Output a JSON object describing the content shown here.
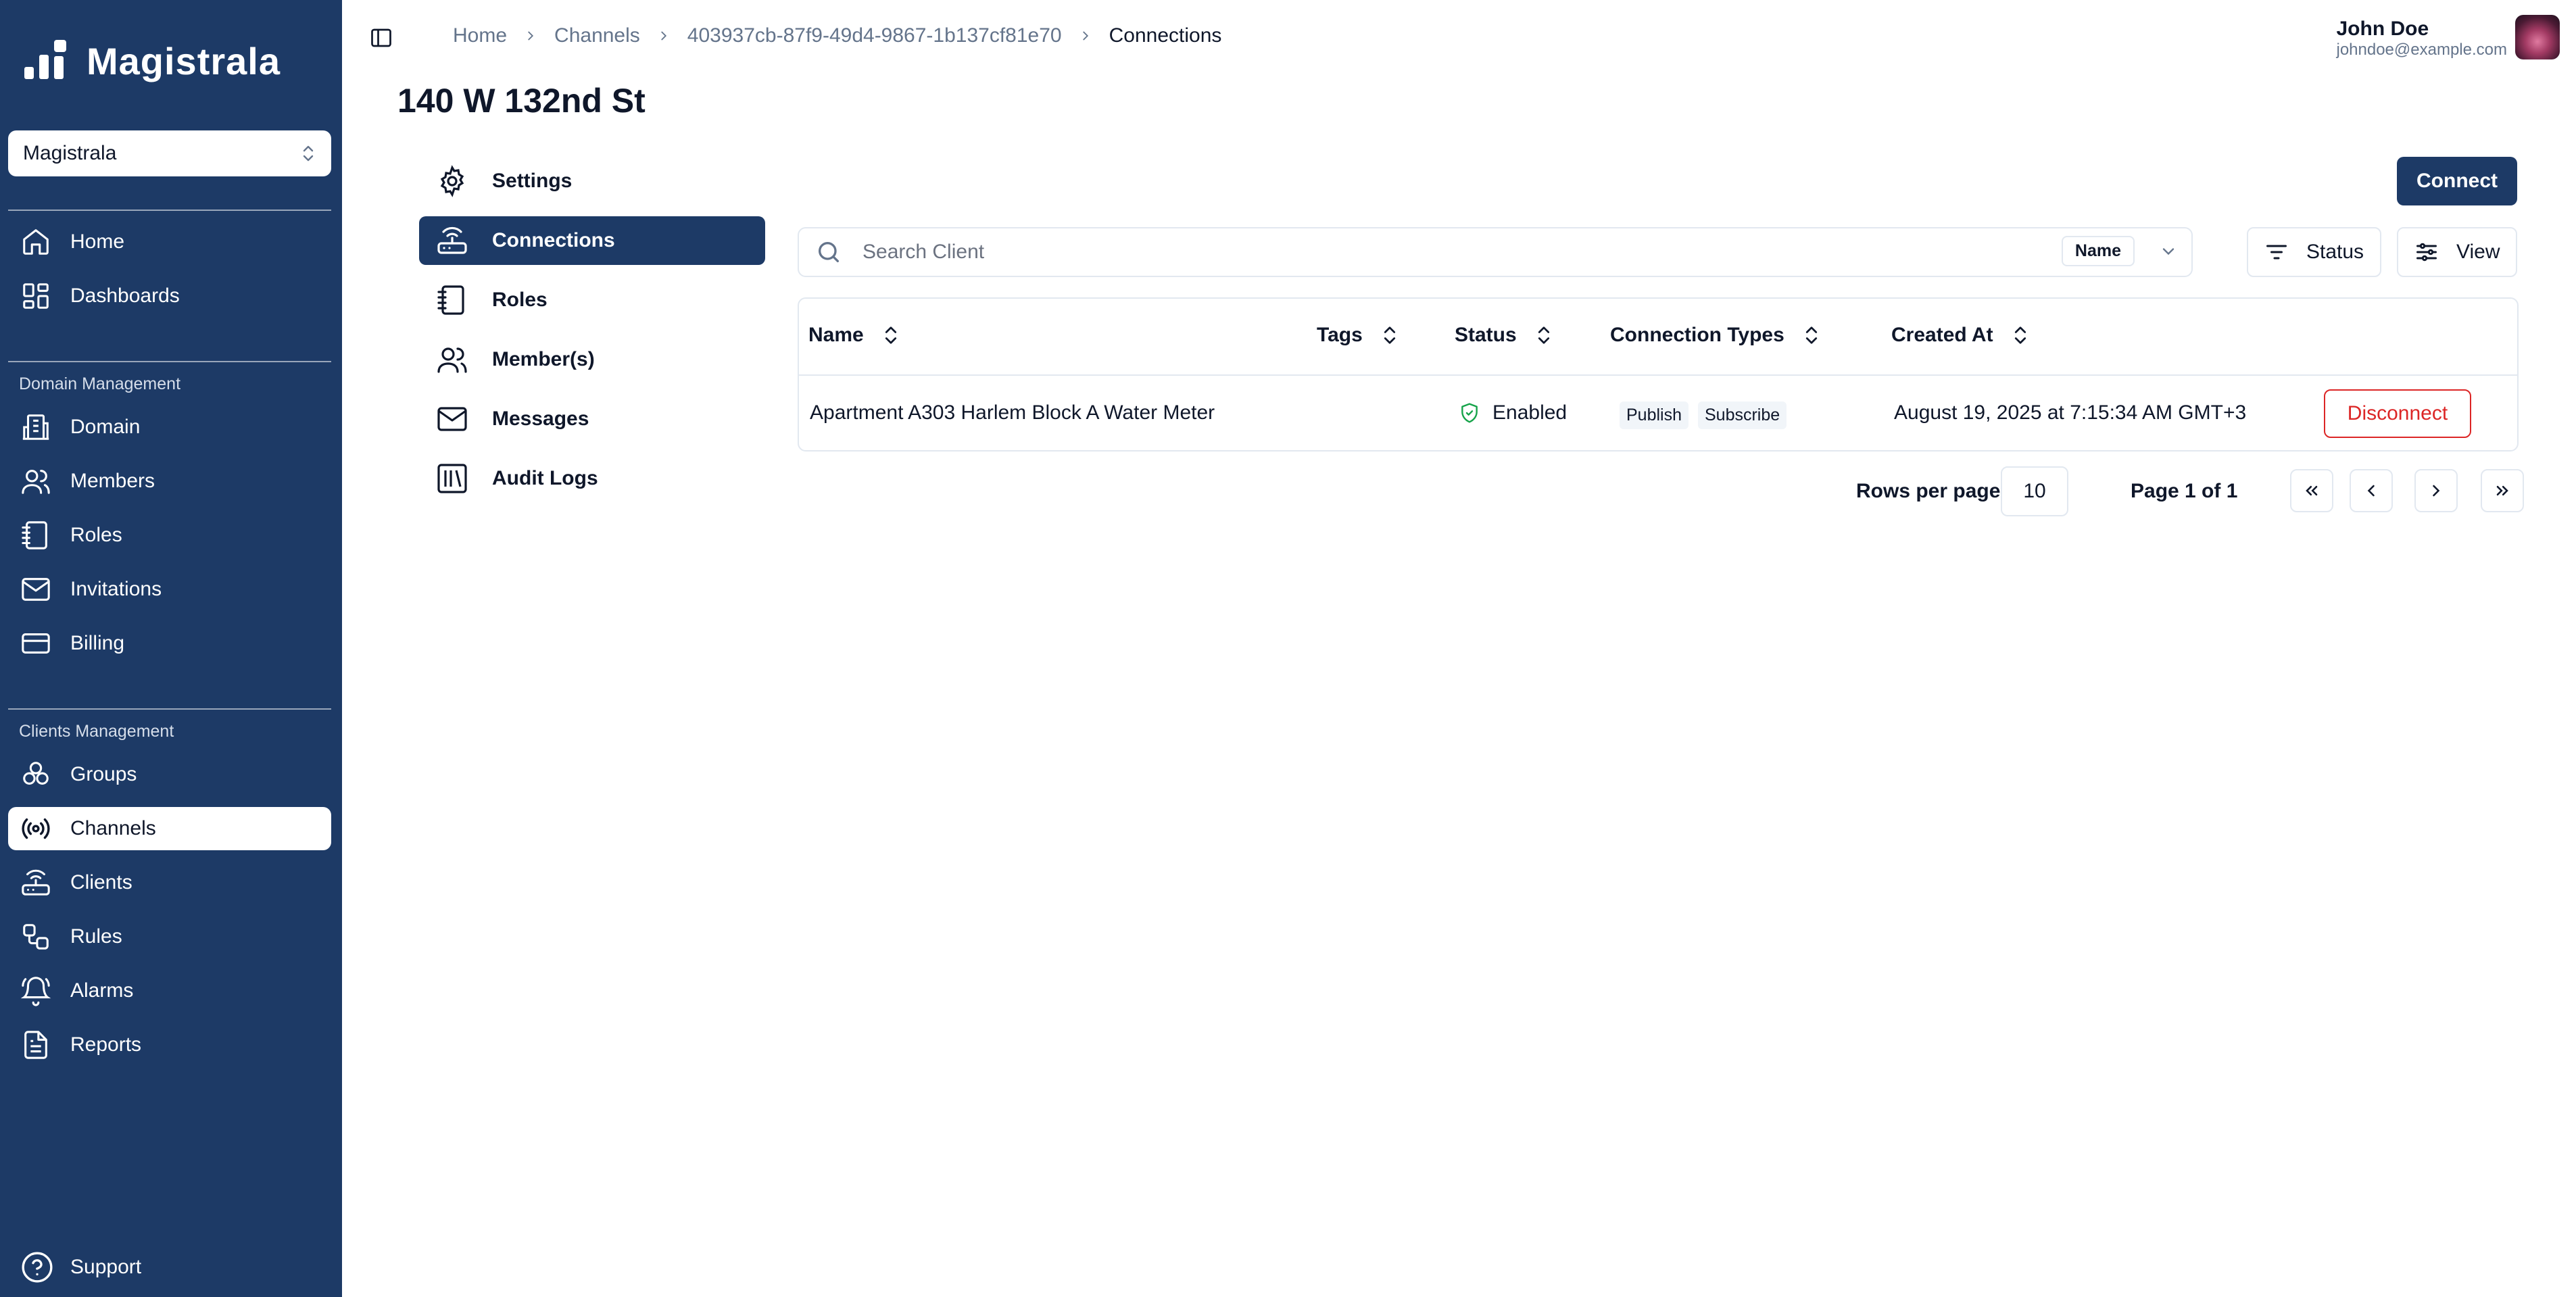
{
  "brand": {
    "name": "Magistrala"
  },
  "domain_selector": {
    "value": "Magistrala"
  },
  "sidebar": {
    "top_items": [
      {
        "label": "Home",
        "icon": "home-icon"
      },
      {
        "label": "Dashboards",
        "icon": "dashboard-icon"
      }
    ],
    "domain_section_label": "Domain Management",
    "domain_items": [
      {
        "label": "Domain",
        "icon": "building-icon"
      },
      {
        "label": "Members",
        "icon": "users-icon"
      },
      {
        "label": "Roles",
        "icon": "notebook-icon"
      },
      {
        "label": "Invitations",
        "icon": "mail-icon"
      },
      {
        "label": "Billing",
        "icon": "credit-card-icon"
      }
    ],
    "clients_section_label": "Clients Management",
    "clients_items": [
      {
        "label": "Groups",
        "icon": "groups-icon"
      },
      {
        "label": "Channels",
        "icon": "radio-icon",
        "active": true
      },
      {
        "label": "Clients",
        "icon": "router-icon"
      },
      {
        "label": "Rules",
        "icon": "workflow-icon"
      },
      {
        "label": "Alarms",
        "icon": "bell-icon"
      },
      {
        "label": "Reports",
        "icon": "file-text-icon"
      }
    ],
    "support_label": "Support"
  },
  "breadcrumb": [
    "Home",
    "Channels",
    "403937cb-87f9-49d4-9867-1b137cf81e70",
    "Connections"
  ],
  "user": {
    "name": "John Doe",
    "email": "johndoe@example.com"
  },
  "page": {
    "title": "140 W 132nd St"
  },
  "subnav": [
    {
      "label": "Settings",
      "icon": "gear-icon"
    },
    {
      "label": "Connections",
      "icon": "router-icon",
      "active": true
    },
    {
      "label": "Roles",
      "icon": "notebook-icon"
    },
    {
      "label": "Member(s)",
      "icon": "users-icon"
    },
    {
      "label": "Messages",
      "icon": "mail-icon"
    },
    {
      "label": "Audit Logs",
      "icon": "library-icon"
    }
  ],
  "toolbar": {
    "connect_label": "Connect",
    "search_placeholder": "Search Client",
    "search_filter": "Name",
    "status_label": "Status",
    "view_label": "View"
  },
  "table": {
    "columns": [
      "Name",
      "Tags",
      "Status",
      "Connection Types",
      "Created At"
    ],
    "rows": [
      {
        "name": "Apartment A303 Harlem Block A Water Meter",
        "tags": "",
        "status": "Enabled",
        "connection_types": [
          "Publish",
          "Subscribe"
        ],
        "created_at": "August 19, 2025 at 7:15:34 AM GMT+3",
        "action": "Disconnect"
      }
    ]
  },
  "pagination": {
    "rows_per_page_label": "Rows per page",
    "rows_per_page": "10",
    "page_info": "Page 1 of 1"
  },
  "colors": {
    "primary": "#1d3a66",
    "danger": "#dc2626",
    "border": "#e2e8f0"
  }
}
